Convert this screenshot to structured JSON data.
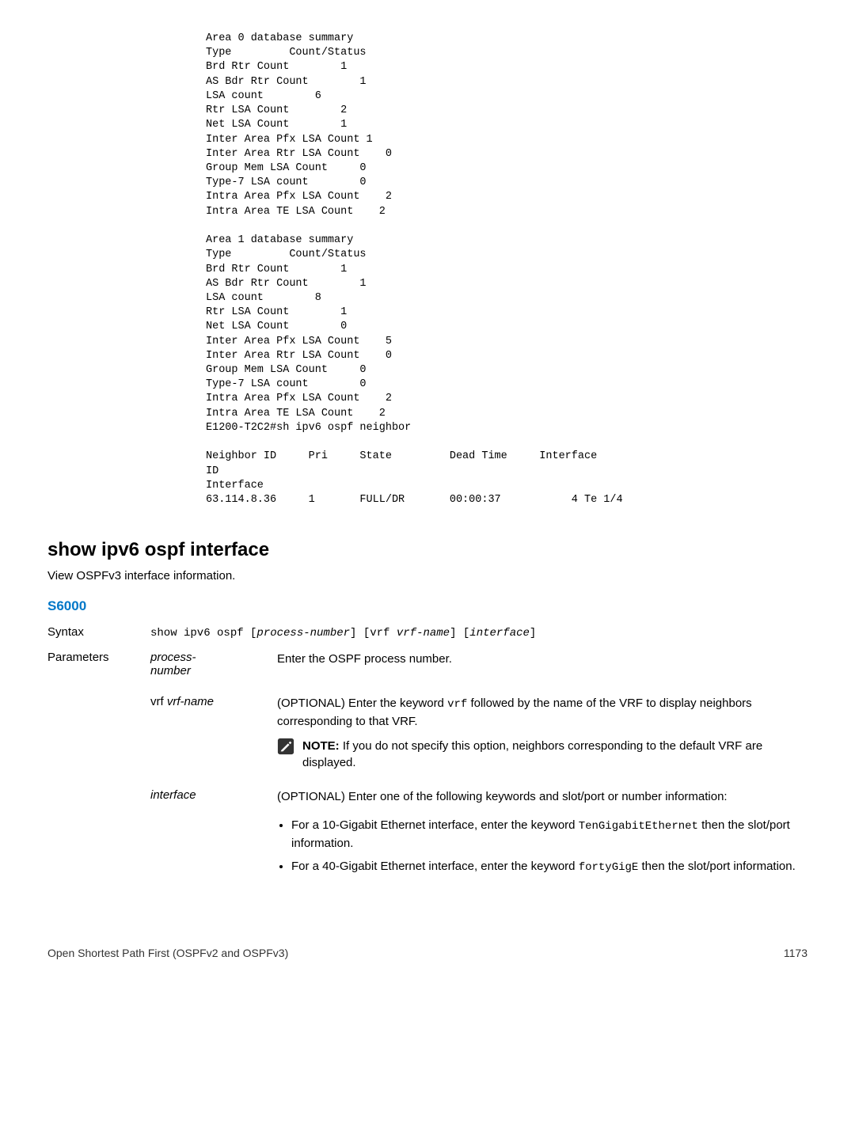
{
  "code_block": "Area 0 database summary\nType         Count/Status\nBrd Rtr Count        1\nAS Bdr Rtr Count        1\nLSA count        6\nRtr LSA Count        2\nNet LSA Count        1\nInter Area Pfx LSA Count 1\nInter Area Rtr LSA Count    0\nGroup Mem LSA Count     0\nType-7 LSA count        0\nIntra Area Pfx LSA Count    2\nIntra Area TE LSA Count    2\n\nArea 1 database summary\nType         Count/Status\nBrd Rtr Count        1\nAS Bdr Rtr Count        1\nLSA count        8\nRtr LSA Count        1\nNet LSA Count        0\nInter Area Pfx LSA Count    5\nInter Area Rtr LSA Count    0\nGroup Mem LSA Count     0\nType-7 LSA count        0\nIntra Area Pfx LSA Count    2\nIntra Area TE LSA Count    2\nE1200-T2C2#sh ipv6 ospf neighbor\n\nNeighbor ID     Pri     State         Dead Time     Interface \nID     \nInterface\n63.114.8.36     1       FULL/DR       00:00:37           4 Te 1/4",
  "section": {
    "title": "show ipv6 ospf interface",
    "desc": "View OSPFv3 interface information."
  },
  "platform": "S6000",
  "syntax": {
    "label": "Syntax",
    "cmd_prefix": "show ipv6 ospf [",
    "arg1": "process-number",
    "mid1": "] [vrf ",
    "arg2": "vrf-name",
    "mid2": "] [",
    "arg3": "interface",
    "suffix": "]"
  },
  "parameters_label": "Parameters",
  "params": {
    "process_number": {
      "name": "process-\nnumber",
      "desc": "Enter the OSPF process number."
    },
    "vrf": {
      "label_prefix": "vrf ",
      "label_ital": "vrf-name",
      "desc_pre": "(OPTIONAL) Enter the keyword ",
      "desc_kw": "vrf",
      "desc_post": " followed by the name of the VRF to display neighbors corresponding to that VRF.",
      "note_bold": "NOTE: ",
      "note_text": "If you do not specify this option, neighbors corresponding to the default VRF are displayed."
    },
    "interface": {
      "name": "interface",
      "desc": "(OPTIONAL) Enter one of the following keywords and slot/port or number information:",
      "bullet1_pre": "For a 10-Gigabit Ethernet interface, enter the keyword ",
      "bullet1_code": "TenGigabitEthernet",
      "bullet1_post": " then the slot/port information.",
      "bullet2_pre": "For a 40-Gigabit Ethernet interface, enter the keyword ",
      "bullet2_code": "fortyGigE",
      "bullet2_post": " then the slot/port information."
    }
  },
  "footer": {
    "left": "Open Shortest Path First (OSPFv2 and OSPFv3)",
    "right": "1173"
  }
}
